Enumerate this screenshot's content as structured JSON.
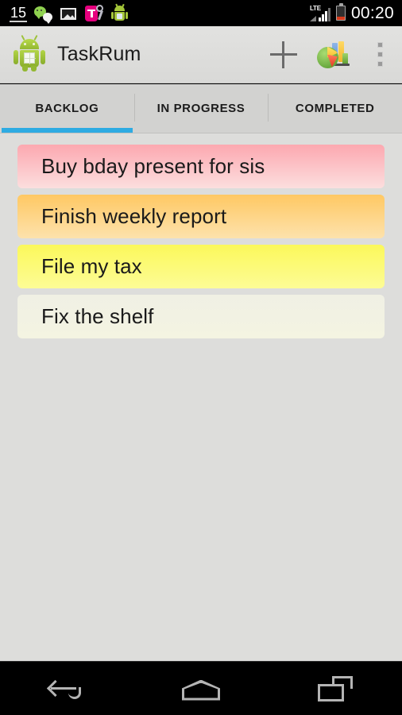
{
  "status_bar": {
    "notification_count": "15",
    "icons": [
      {
        "name": "wechat-icon",
        "label": "WeChat"
      },
      {
        "name": "gallery-icon",
        "label": "Gallery"
      },
      {
        "name": "tmobile-icon",
        "label": "T-Mobile"
      },
      {
        "name": "android-app-icon",
        "label": "Android"
      }
    ],
    "network_type": "LTE",
    "clock": "00:20",
    "battery_state": "low"
  },
  "action_bar": {
    "app_icon_name": "taskrum-app-icon",
    "title": "TaskRum",
    "add_button_label": "+",
    "add_button_name": "add-task-button",
    "stats_button_name": "statistics-chart-button",
    "overflow_button_name": "overflow-menu-button"
  },
  "tabs": {
    "active_index": 0,
    "indicator_color": "#2eabe2",
    "items": [
      {
        "label": "BACKLOG",
        "name": "tab-backlog"
      },
      {
        "label": "IN PROGRESS",
        "name": "tab-in-progress"
      },
      {
        "label": "COMPLETED",
        "name": "tab-completed"
      }
    ]
  },
  "task_list": {
    "background": "#dddddb",
    "tasks": [
      {
        "title": "Buy bday present for sis",
        "priority_color_top": "#fca8b0",
        "priority_color_bottom": "#fcdede"
      },
      {
        "title": "Finish weekly report",
        "priority_color_top": "#ffc863",
        "priority_color_bottom": "#fde2ac"
      },
      {
        "title": "File my tax",
        "priority_color_top": "#fbf85a",
        "priority_color_bottom": "#fdfc96"
      },
      {
        "title": "Fix the shelf",
        "priority_color_top": "#f0f0e4",
        "priority_color_bottom": "#f4f4e2"
      }
    ]
  },
  "nav_bar": {
    "back_label": "Back",
    "home_label": "Home",
    "recents_label": "Recent apps"
  }
}
